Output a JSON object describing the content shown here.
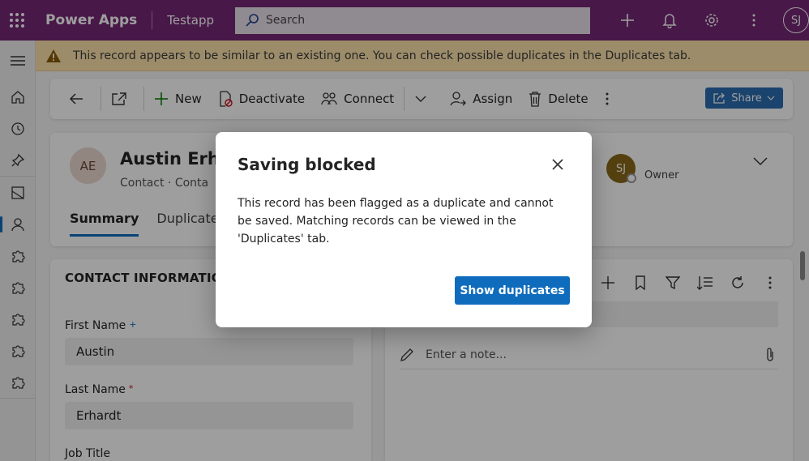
{
  "topbar": {
    "brand": "Power Apps",
    "app_name": "Testapp",
    "search_placeholder": "Search",
    "user_initials": "SJ"
  },
  "warning": {
    "message": "This record appears to be similar to an existing one. You can check possible duplicates in the Duplicates tab."
  },
  "commands": {
    "new": "New",
    "deactivate": "Deactivate",
    "connect": "Connect",
    "assign": "Assign",
    "delete": "Delete",
    "share": "Share"
  },
  "record": {
    "initials": "AE",
    "name": "Austin Erhar",
    "entity": "Contact",
    "form": "Conta",
    "owner_initials": "SJ",
    "owner_label": "Owner",
    "tabs": [
      "Summary",
      "Duplicates"
    ]
  },
  "contact_info": {
    "title": "CONTACT INFORMATION",
    "first_name_label": "First Name",
    "first_name_value": "Austin",
    "last_name_label": "Last Name",
    "last_name_value": "Erhardt",
    "job_title_label": "Job Title"
  },
  "timeline": {
    "note_placeholder": "Enter a note..."
  },
  "dialog": {
    "title": "Saving blocked",
    "body": "This record has been flagged as a duplicate and cannot be saved. Matching records can be viewed in the 'Duplicates' tab.",
    "button": "Show duplicates"
  },
  "colors": {
    "topbar": "#742774",
    "warning_bg": "#fce2ab",
    "primary": "#0f6cbd"
  }
}
